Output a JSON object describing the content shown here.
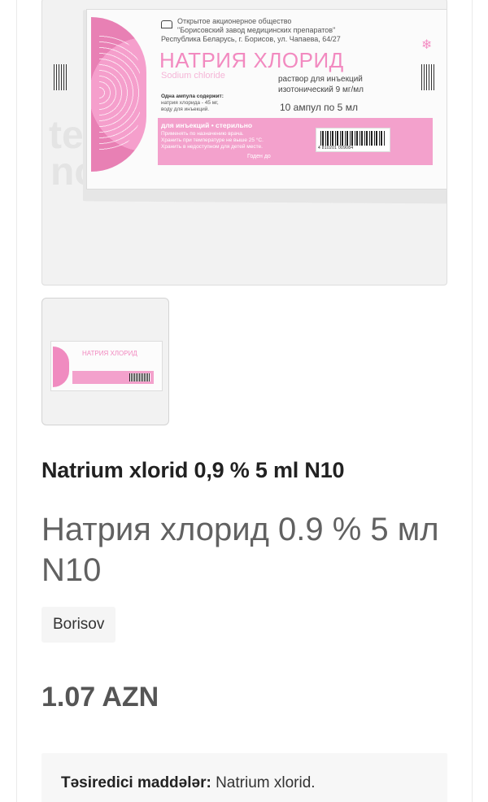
{
  "product": {
    "name_az": "Natrium xlorid 0,9 % 5 ml N10",
    "name_ru": "Натрия хлорид 0.9 % 5 мл N10",
    "brand": "Borisov",
    "price": "1.07 AZN",
    "active_label": "Təsiredici maddələr:",
    "active_value": " Natrium xlorid."
  },
  "package": {
    "manufacturer_lines": [
      "Открытое акционерное общество",
      "\"Борисовский завод медицинских препаратов\"",
      "Республика Беларусь, г. Борисов, ул. Чапаева, 64/27"
    ],
    "title": "НАТРИЯ ХЛОРИД",
    "subtitle": "Sodium chloride",
    "solution_lines": [
      "раствор для инъекций",
      "изотонический 9 мг/мл"
    ],
    "ampoules": "10 ампул по 5 мл",
    "content_head": "Одна ампула содержит:",
    "content_lines": [
      "натрия хлорида - 45 мг,",
      "воду для инъекций."
    ],
    "band_head": "для инъекций • стерильно",
    "band_lines": [
      "Применять по назначению врача.",
      "Хранить при температуре не выше 25 °С.",
      "Хранить в недоступном для детей месте."
    ],
    "expiry": "Годен до",
    "barcode_number": "4 810201 009084",
    "thumb_title": "НАТРИЯ ХЛОРИД"
  }
}
